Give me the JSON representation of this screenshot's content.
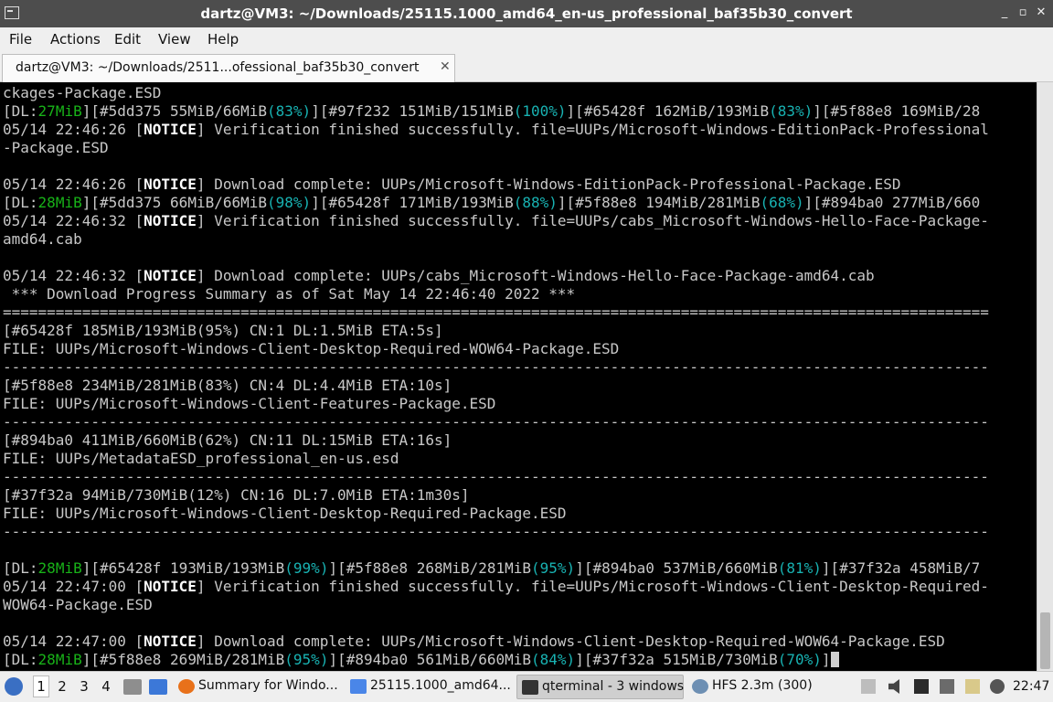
{
  "window": {
    "title": "dartz@VM3: ~/Downloads/25115.1000_amd64_en-us_professional_baf35b30_convert",
    "minimize_glyph": "_",
    "maximize_glyph": "▫",
    "close_glyph": "✕",
    "icon": "terminal-window-icon"
  },
  "menu": [
    "File",
    "Actions",
    "Edit",
    "View",
    "Help"
  ],
  "tab": {
    "label": "dartz@VM3: ~/Downloads/2511...ofessional_baf35b30_convert",
    "close_glyph": "✕"
  },
  "terminal_lines": [
    [
      [
        "d",
        "ckages-Package.ESD"
      ]
    ],
    [
      [
        "d",
        "["
      ],
      [
        "d",
        "DL:"
      ],
      [
        "g",
        "27MiB"
      ],
      [
        "d",
        "]["
      ],
      [
        "d",
        "#5dd375 55MiB/66MiB"
      ],
      [
        "c",
        "(83%)"
      ],
      [
        "d",
        "]["
      ],
      [
        "d",
        "#97f232 151MiB/151MiB"
      ],
      [
        "c",
        "(100%)"
      ],
      [
        "d",
        "]["
      ],
      [
        "d",
        "#65428f 162MiB/193MiB"
      ],
      [
        "c",
        "(83%)"
      ],
      [
        "d",
        "]["
      ],
      [
        "d",
        "#5f88e8 169MiB/28"
      ]
    ],
    [
      [
        "d",
        "05/14 22:46:26 ["
      ],
      [
        "b",
        "NOTICE"
      ],
      [
        "d",
        "] Verification finished successfully. file=UUPs/Microsoft-Windows-EditionPack-Professional"
      ]
    ],
    [
      [
        "d",
        "-Package.ESD"
      ]
    ],
    [],
    [
      [
        "d",
        "05/14 22:46:26 ["
      ],
      [
        "b",
        "NOTICE"
      ],
      [
        "d",
        "] Download complete: UUPs/Microsoft-Windows-EditionPack-Professional-Package.ESD"
      ]
    ],
    [
      [
        "d",
        "["
      ],
      [
        "d",
        "DL:"
      ],
      [
        "g",
        "28MiB"
      ],
      [
        "d",
        "]["
      ],
      [
        "d",
        "#5dd375 66MiB/66MiB"
      ],
      [
        "c",
        "(98%)"
      ],
      [
        "d",
        "]["
      ],
      [
        "d",
        "#65428f 171MiB/193MiB"
      ],
      [
        "c",
        "(88%)"
      ],
      [
        "d",
        "]["
      ],
      [
        "d",
        "#5f88e8 194MiB/281MiB"
      ],
      [
        "c",
        "(68%)"
      ],
      [
        "d",
        "]["
      ],
      [
        "d",
        "#894ba0 277MiB/660"
      ]
    ],
    [
      [
        "d",
        "05/14 22:46:32 ["
      ],
      [
        "b",
        "NOTICE"
      ],
      [
        "d",
        "] Verification finished successfully. file=UUPs/cabs_Microsoft-Windows-Hello-Face-Package-"
      ]
    ],
    [
      [
        "d",
        "amd64.cab"
      ]
    ],
    [],
    [
      [
        "d",
        "05/14 22:46:32 ["
      ],
      [
        "b",
        "NOTICE"
      ],
      [
        "d",
        "] Download complete: UUPs/cabs_Microsoft-Windows-Hello-Face-Package-amd64.cab"
      ]
    ],
    [
      [
        "d",
        " *** Download Progress Summary as of Sat May 14 22:46:40 2022 ***"
      ]
    ],
    [
      [
        "d",
        "================================================================================================================"
      ]
    ],
    [
      [
        "d",
        "[#65428f 185MiB/193MiB(95%) CN:1 DL:1.5MiB ETA:5s]"
      ]
    ],
    [
      [
        "d",
        "FILE: UUPs/Microsoft-Windows-Client-Desktop-Required-WOW64-Package.ESD"
      ]
    ],
    [
      [
        "d",
        "----------------------------------------------------------------------------------------------------------------"
      ]
    ],
    [
      [
        "d",
        "[#5f88e8 234MiB/281MiB(83%) CN:4 DL:4.4MiB ETA:10s]"
      ]
    ],
    [
      [
        "d",
        "FILE: UUPs/Microsoft-Windows-Client-Features-Package.ESD"
      ]
    ],
    [
      [
        "d",
        "----------------------------------------------------------------------------------------------------------------"
      ]
    ],
    [
      [
        "d",
        "[#894ba0 411MiB/660MiB(62%) CN:11 DL:15MiB ETA:16s]"
      ]
    ],
    [
      [
        "d",
        "FILE: UUPs/MetadataESD_professional_en-us.esd"
      ]
    ],
    [
      [
        "d",
        "----------------------------------------------------------------------------------------------------------------"
      ]
    ],
    [
      [
        "d",
        "[#37f32a 94MiB/730MiB(12%) CN:16 DL:7.0MiB ETA:1m30s]"
      ]
    ],
    [
      [
        "d",
        "FILE: UUPs/Microsoft-Windows-Client-Desktop-Required-Package.ESD"
      ]
    ],
    [
      [
        "d",
        "----------------------------------------------------------------------------------------------------------------"
      ]
    ],
    [],
    [
      [
        "d",
        "["
      ],
      [
        "d",
        "DL:"
      ],
      [
        "g",
        "28MiB"
      ],
      [
        "d",
        "]["
      ],
      [
        "d",
        "#65428f 193MiB/193MiB"
      ],
      [
        "c",
        "(99%)"
      ],
      [
        "d",
        "]["
      ],
      [
        "d",
        "#5f88e8 268MiB/281MiB"
      ],
      [
        "c",
        "(95%)"
      ],
      [
        "d",
        "]["
      ],
      [
        "d",
        "#894ba0 537MiB/660MiB"
      ],
      [
        "c",
        "(81%)"
      ],
      [
        "d",
        "]["
      ],
      [
        "d",
        "#37f32a 458MiB/7"
      ]
    ],
    [
      [
        "d",
        "05/14 22:47:00 ["
      ],
      [
        "b",
        "NOTICE"
      ],
      [
        "d",
        "] Verification finished successfully. file=UUPs/Microsoft-Windows-Client-Desktop-Required-"
      ]
    ],
    [
      [
        "d",
        "WOW64-Package.ESD"
      ]
    ],
    [],
    [
      [
        "d",
        "05/14 22:47:00 ["
      ],
      [
        "b",
        "NOTICE"
      ],
      [
        "d",
        "] Download complete: UUPs/Microsoft-Windows-Client-Desktop-Required-WOW64-Package.ESD"
      ]
    ],
    [
      [
        "d",
        "["
      ],
      [
        "d",
        "DL:"
      ],
      [
        "g",
        "28MiB"
      ],
      [
        "d",
        "]["
      ],
      [
        "d",
        "#5f88e8 269MiB/281MiB"
      ],
      [
        "c",
        "(95%)"
      ],
      [
        "d",
        "]["
      ],
      [
        "d",
        "#894ba0 561MiB/660MiB"
      ],
      [
        "c",
        "(84%)"
      ],
      [
        "d",
        "]["
      ],
      [
        "d",
        "#37f32a 515MiB/730MiB"
      ],
      [
        "c",
        "(70%)"
      ],
      [
        "d",
        "]"
      ]
    ]
  ],
  "taskbar": {
    "workspaces": [
      "1",
      "2",
      "3",
      "4"
    ],
    "tasks": [
      {
        "label": "Summary for Windo...",
        "icon": "firefox-icon"
      },
      {
        "label": "25115.1000_amd64...",
        "icon": "folder-icon"
      },
      {
        "label": "qterminal - 3 windows",
        "icon": "terminal-icon"
      },
      {
        "label": "HFS 2.3m (300)",
        "icon": "hfs-icon"
      }
    ],
    "tray_icons": [
      "volume-icon",
      "hfs-tray-icon",
      "network-icon",
      "clipboard-icon",
      "power-icon"
    ],
    "clock": "22:47"
  },
  "colors": {
    "title_bar": "#4d4d4d",
    "terminal_bg": "#000000",
    "terminal_text": "#c8c8c8",
    "green": "#18b218",
    "cyan": "#18b2b2"
  }
}
